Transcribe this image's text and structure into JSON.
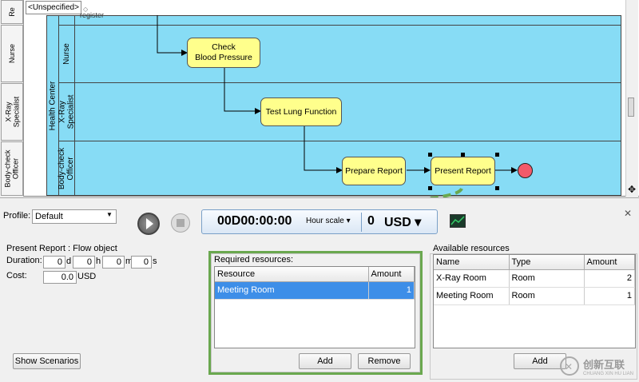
{
  "side_tabs": [
    "Re",
    "Nurse",
    "X-Ray\nSpecialist",
    "Body-check\nOfficer"
  ],
  "diagram": {
    "scope": "<Unspecified>",
    "pool_name": "Health Center",
    "lanes": [
      "Nurse",
      "X-Ray\nSpecialist",
      "Body-check\nOfficer"
    ],
    "top_partial_text": "register",
    "actions": {
      "check_bp": "Check\nBlood Pressure",
      "test_lung": "Test Lung Function",
      "prepare_report": "Prepare Report",
      "present_report": "Present Report"
    }
  },
  "toolbar": {
    "profile_label": "Profile:",
    "profile_value": "Default",
    "clock_time": "00D00:00:00",
    "clock_scale": "Hour scale ▾",
    "cost_value": "0",
    "currency": "USD ▾"
  },
  "details": {
    "title": "Present Report : Flow object",
    "duration_label": "Duration:",
    "days": "0",
    "days_unit": "d",
    "hours": "0",
    "hours_unit": "h",
    "minutes": "0",
    "minutes_unit": "m",
    "seconds": "0",
    "seconds_unit": "s",
    "cost_label": "Cost:",
    "cost": "0.0",
    "cost_unit": "USD",
    "show_scenarios": "Show Scenarios"
  },
  "required": {
    "title": "Required resources:",
    "columns": [
      "Resource",
      "Amount"
    ],
    "rows": [
      {
        "resource": "Meeting Room",
        "amount": "1"
      }
    ],
    "add_label": "Add",
    "remove_label": "Remove"
  },
  "available": {
    "title": "Available resources",
    "columns": [
      "Name",
      "Type",
      "Amount"
    ],
    "rows": [
      {
        "name": "X-Ray Room",
        "type": "Room",
        "amount": "2"
      },
      {
        "name": "Meeting Room",
        "type": "Room",
        "amount": "1"
      }
    ],
    "add_label": "Add"
  },
  "watermark": {
    "brand": "创新互联",
    "sub": "CHUANG XIN HU LIAN"
  },
  "colors": {
    "pool": "#87dcf5",
    "action": "#ffff8c",
    "highlight": "#6aa84f",
    "selection": "#3d8ee8",
    "end": "#f25a6a"
  }
}
